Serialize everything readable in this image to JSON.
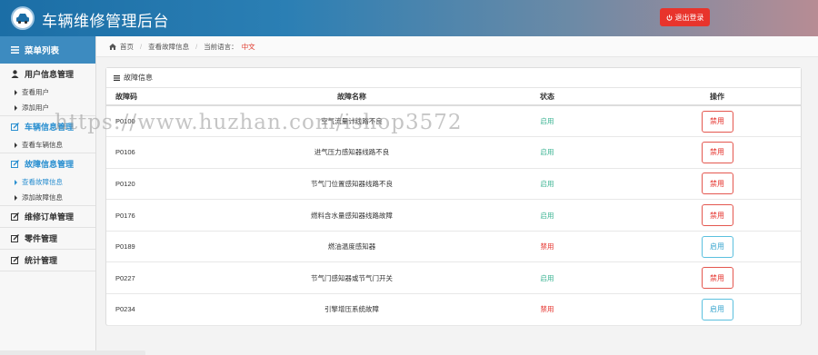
{
  "header": {
    "title": "车辆维修管理后台",
    "logout_label": "退出登录"
  },
  "sidebar": {
    "menu_title": "菜单列表",
    "groups": [
      {
        "label": "用户信息管理",
        "items": [
          "查看用户",
          "添加用户"
        ]
      },
      {
        "label": "车辆信息管理",
        "items": [
          "查看车辆信息"
        ]
      },
      {
        "label": "故障信息管理",
        "items": [
          "查看故障信息",
          "添加故障信息"
        ]
      },
      {
        "label": "维修订单管理",
        "items": []
      },
      {
        "label": "零件管理",
        "items": []
      },
      {
        "label": "统计管理",
        "items": []
      }
    ]
  },
  "breadcrumb": {
    "home": "首页",
    "current": "查看故障信息",
    "lang_label": "当前语言：",
    "lang_value": "中文"
  },
  "panel": {
    "title": "故障信息",
    "columns": [
      "故障码",
      "故障名称",
      "状态",
      "操作"
    ],
    "rows": [
      {
        "code": "P0100",
        "name": "空气流量计线路不良",
        "status": "启用",
        "action": "禁用"
      },
      {
        "code": "P0106",
        "name": "进气压力感知器线路不良",
        "status": "启用",
        "action": "禁用"
      },
      {
        "code": "P0120",
        "name": "节气门位置感知器线路不良",
        "status": "启用",
        "action": "禁用"
      },
      {
        "code": "P0176",
        "name": "燃料含水量感知器线路故障",
        "status": "启用",
        "action": "禁用"
      },
      {
        "code": "P0189",
        "name": "燃油温度感知器",
        "status": "禁用",
        "action": "启用"
      },
      {
        "code": "P0227",
        "name": "节气门感知器或节气门开关",
        "status": "启用",
        "action": "禁用"
      },
      {
        "code": "P0234",
        "name": "引擎增压系统故障",
        "status": "禁用",
        "action": "启用"
      }
    ]
  },
  "watermark": "https://www.huzhan.com/ishop3572",
  "colors": {
    "accent": "#3d8bc0",
    "enabled": "#35b18f",
    "disabled": "#e4312b",
    "logout": "#e8342c"
  }
}
